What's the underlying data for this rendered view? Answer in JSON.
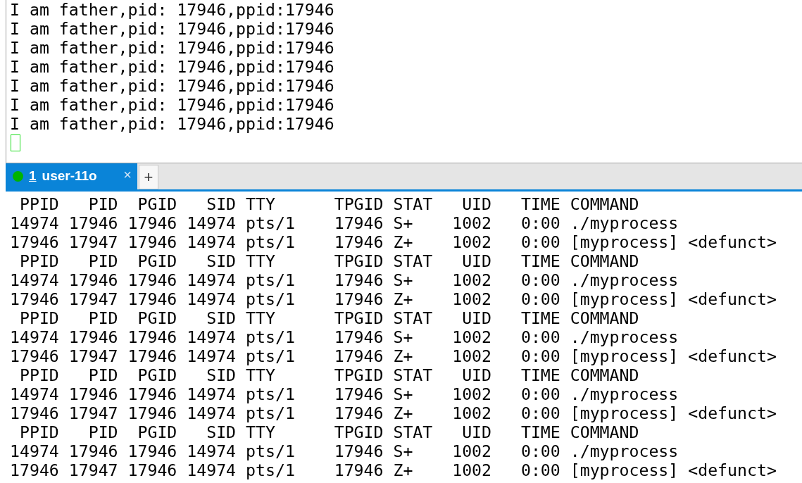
{
  "top_terminal": {
    "lines": [
      "I am father,pid: 17946,ppid:17946",
      "I am father,pid: 17946,ppid:17946",
      "I am father,pid: 17946,ppid:17946",
      "I am father,pid: 17946,ppid:17946",
      "I am father,pid: 17946,ppid:17946",
      "I am father,pid: 17946,ppid:17946",
      "I am father,pid: 17946,ppid:17946"
    ],
    "cursor": true
  },
  "tabs": [
    {
      "number": "1",
      "label": "user-11o",
      "selected": true,
      "color": "#00b400",
      "close": "×"
    }
  ],
  "new_tab": "+",
  "bottom_terminal": {
    "lines": [
      " PPID   PID  PGID   SID TTY      TPGID STAT   UID   TIME COMMAND",
      "14974 17946 17946 14974 pts/1    17946 S+    1002   0:00 ./myprocess",
      "17946 17947 17946 14974 pts/1    17946 Z+    1002   0:00 [myprocess] <defunct>",
      " PPID   PID  PGID   SID TTY      TPGID STAT   UID   TIME COMMAND",
      "14974 17946 17946 14974 pts/1    17946 S+    1002   0:00 ./myprocess",
      "17946 17947 17946 14974 pts/1    17946 Z+    1002   0:00 [myprocess] <defunct>",
      " PPID   PID  PGID   SID TTY      TPGID STAT   UID   TIME COMMAND",
      "14974 17946 17946 14974 pts/1    17946 S+    1002   0:00 ./myprocess",
      "17946 17947 17946 14974 pts/1    17946 Z+    1002   0:00 [myprocess] <defunct>",
      " PPID   PID  PGID   SID TTY      TPGID STAT   UID   TIME COMMAND",
      "14974 17946 17946 14974 pts/1    17946 S+    1002   0:00 ./myprocess",
      "17946 17947 17946 14974 pts/1    17946 Z+    1002   0:00 [myprocess] <defunct>",
      " PPID   PID  PGID   SID TTY      TPGID STAT   UID   TIME COMMAND",
      "14974 17946 17946 14974 pts/1    17946 S+    1002   0:00 ./myprocess",
      "17946 17947 17946 14974 pts/1    17946 Z+    1002   0:00 [myprocess] <defunct>"
    ]
  }
}
